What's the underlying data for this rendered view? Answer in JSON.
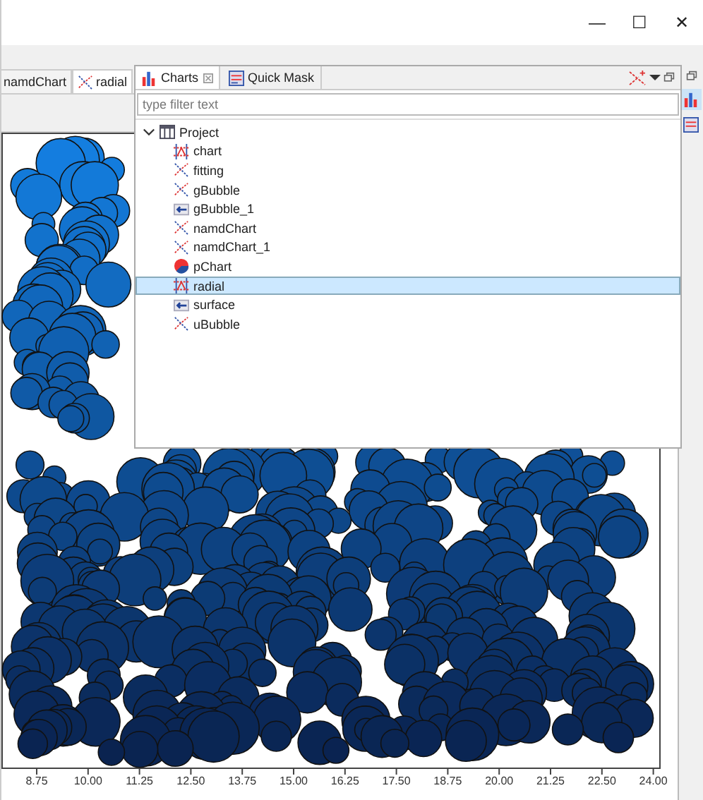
{
  "window": {
    "controls": [
      "—",
      "☐",
      "✕"
    ]
  },
  "editor_tabs": [
    {
      "label": "namdChart",
      "selected": false
    },
    {
      "label": "radial",
      "selected": true
    }
  ],
  "chart": {
    "x_axis_labels": [
      "8.75",
      "10.00",
      "11.25",
      "12.50",
      "13.75",
      "15.00",
      "16.25",
      "17.50",
      "18.75",
      "20.00",
      "21.25",
      "22.50",
      "24.00"
    ]
  },
  "panel": {
    "tabs": [
      {
        "label": "Charts",
        "selected": true,
        "closable": true
      },
      {
        "label": "Quick Mask",
        "selected": false,
        "closable": false
      }
    ],
    "filter": {
      "placeholder": "type filter text"
    },
    "tree": [
      {
        "label": "Project",
        "expanded": true,
        "selected": false,
        "children": [
          {
            "label": "chart",
            "kind": "grid",
            "selected": false
          },
          {
            "label": "fitting",
            "kind": "scatter",
            "selected": false
          },
          {
            "label": "gBubble",
            "kind": "scatter",
            "selected": false
          },
          {
            "label": "gBubble_1",
            "kind": "arrow",
            "selected": false
          },
          {
            "label": "namdChart",
            "kind": "scatter",
            "selected": false
          },
          {
            "label": "namdChart_1",
            "kind": "scatter",
            "selected": false
          },
          {
            "label": "pChart",
            "kind": "pie",
            "selected": false
          },
          {
            "label": "radial",
            "kind": "grid",
            "selected": true
          },
          {
            "label": "surface",
            "kind": "arrow",
            "selected": false
          },
          {
            "label": "uBubble",
            "kind": "scatter",
            "selected": false
          }
        ]
      }
    ]
  },
  "side_trim": [
    {
      "selected": true
    },
    {
      "selected": false
    }
  ]
}
